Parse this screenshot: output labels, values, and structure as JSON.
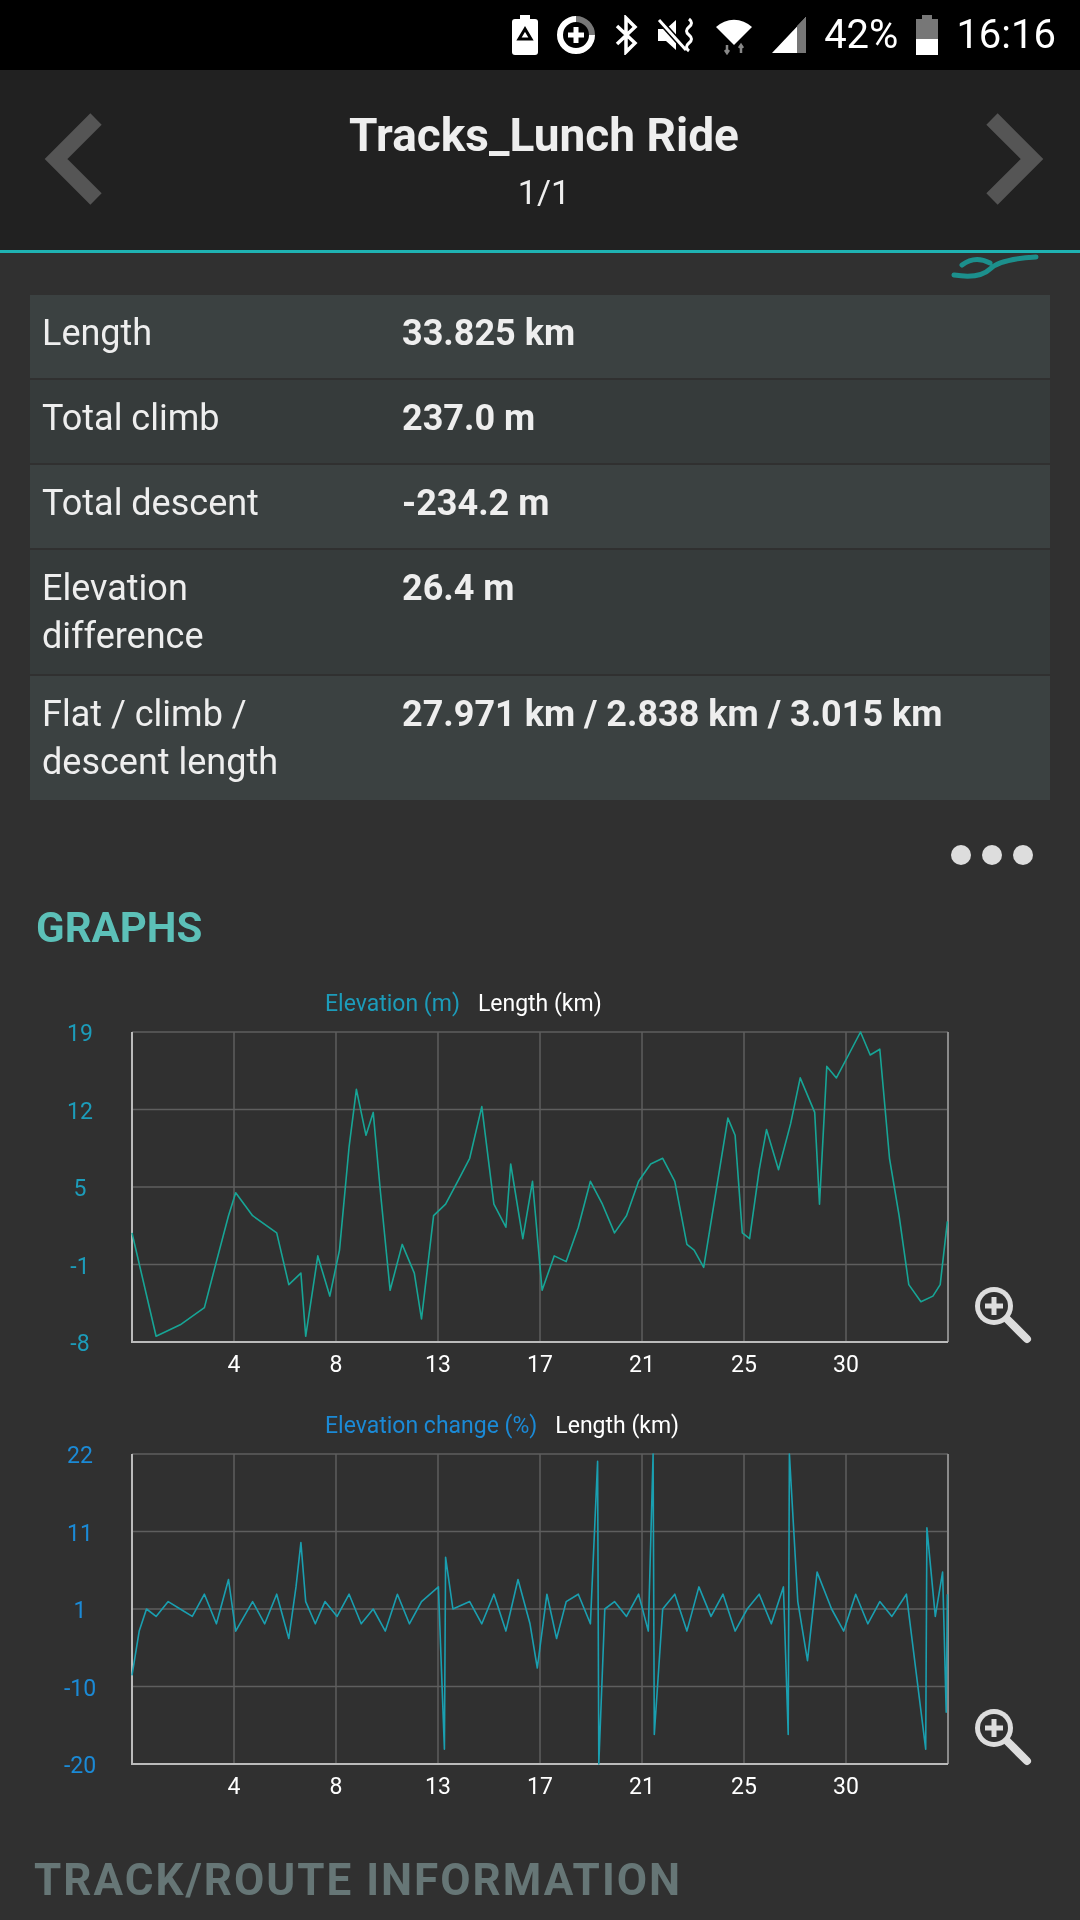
{
  "status_bar": {
    "battery_percent": "42%",
    "time": "16:16"
  },
  "header": {
    "title": "Tracks_Lunch Ride",
    "subtitle": "1/1"
  },
  "statistics": [
    {
      "label": "Length",
      "value": "33.825 km"
    },
    {
      "label": "Total climb",
      "value": "237.0 m"
    },
    {
      "label": "Total descent",
      "value": "-234.2 m"
    },
    {
      "label": "Elevation difference",
      "value": "26.4 m"
    },
    {
      "label": "Flat / climb / descent length",
      "value": "27.971 km / 2.838 km / 3.015 km"
    }
  ],
  "graphs": {
    "title": "GRAPHS",
    "charts": [
      {
        "chart_data": {
          "type": "line",
          "grid": true,
          "xlabel": "Length (km)",
          "xlim": [
            0,
            33.825
          ],
          "ylim": [
            -8,
            19
          ],
          "xticks": [
            {
              "value": 4.228,
              "label": "4"
            },
            {
              "value": 8.456,
              "label": "8"
            },
            {
              "value": 12.684,
              "label": "13"
            },
            {
              "value": 16.913,
              "label": "17"
            },
            {
              "value": 21.141,
              "label": "21"
            },
            {
              "value": 25.369,
              "label": "25"
            },
            {
              "value": 29.597,
              "label": "30"
            }
          ],
          "yticks": [
            {
              "value": -8,
              "label": "-8"
            },
            {
              "value": -1.25,
              "label": "-1"
            },
            {
              "value": 5.5,
              "label": "5"
            },
            {
              "value": 12.25,
              "label": "12"
            },
            {
              "value": 19,
              "label": "19"
            }
          ],
          "x": [
            0,
            1,
            2,
            3,
            3.5,
            4,
            4.3,
            5,
            6,
            6.5,
            7,
            7.2,
            7.7,
            8.2,
            8.6,
            9,
            9.3,
            9.7,
            10,
            10.3,
            10.7,
            11.2,
            11.7,
            12,
            12.5,
            13,
            13.5,
            14,
            14.5,
            15,
            15.5,
            15.7,
            16.2,
            16.6,
            17,
            17.5,
            18,
            18.5,
            19,
            19.5,
            20,
            20.5,
            21,
            21.5,
            22,
            22.5,
            23,
            23.3,
            23.7,
            24.2,
            24.7,
            25,
            25.3,
            25.6,
            26,
            26.3,
            26.8,
            27.3,
            27.7,
            28.3,
            28.5,
            28.8,
            29.2,
            29.7,
            30.2,
            30.6,
            31,
            31.4,
            31.8,
            32.2,
            32.7,
            33.2,
            33.5,
            33.8
          ],
          "series": [
            {
              "name": "Elevation (m)",
              "color": "#17a596",
              "values": [
                1.5,
                -7.5,
                -6.5,
                -5,
                -1,
                3,
                5,
                3,
                1.5,
                -3,
                -2,
                -7.5,
                -0.5,
                -4,
                0,
                9,
                14,
                10,
                12,
                5,
                -3.5,
                0.5,
                -2,
                -6,
                3,
                4,
                6,
                8,
                12.5,
                4,
                2,
                7.5,
                1,
                6,
                -3.5,
                -0.5,
                -1,
                2,
                6,
                4,
                1.5,
                3,
                6,
                7.5,
                8,
                6,
                0.5,
                0,
                -1.5,
                5,
                11.5,
                10,
                1.5,
                1,
                7,
                10.5,
                7,
                11,
                15,
                12,
                4,
                16,
                15,
                17,
                19,
                17,
                17.5,
                8,
                3,
                -3,
                -4.5,
                -4,
                -3,
                2.5
              ]
            }
          ]
        }
      },
      {
        "chart_data": {
          "type": "line",
          "grid": true,
          "xlabel": "Length (km)",
          "xlim": [
            0,
            33.825
          ],
          "ylim": [
            -20,
            22
          ],
          "xticks": [
            {
              "value": 4.228,
              "label": "4"
            },
            {
              "value": 8.456,
              "label": "8"
            },
            {
              "value": 12.684,
              "label": "13"
            },
            {
              "value": 16.913,
              "label": "17"
            },
            {
              "value": 21.141,
              "label": "21"
            },
            {
              "value": 25.369,
              "label": "25"
            },
            {
              "value": 29.597,
              "label": "30"
            }
          ],
          "yticks": [
            {
              "value": -20,
              "label": "-20"
            },
            {
              "value": -9.5,
              "label": "-10"
            },
            {
              "value": 1,
              "label": "1"
            },
            {
              "value": 11.5,
              "label": "11"
            },
            {
              "value": 22,
              "label": "22"
            }
          ],
          "x": [
            0,
            0.3,
            0.6,
            1,
            1.5,
            2,
            2.5,
            3,
            3.5,
            4,
            4.3,
            5,
            5.5,
            6,
            6.5,
            6.8,
            7,
            7.2,
            7.6,
            8,
            8.5,
            9,
            9.5,
            10,
            10.5,
            11,
            11.5,
            12,
            12.7,
            12.95,
            13,
            13.3,
            14,
            14.5,
            15,
            15.5,
            16,
            16.5,
            16.8,
            17.2,
            17.6,
            18,
            18.5,
            19,
            19.3,
            19.35,
            19.6,
            20,
            20.5,
            21,
            21.4,
            21.6,
            21.65,
            22,
            22.5,
            23,
            23.5,
            24,
            24.5,
            25,
            25.5,
            26,
            26.5,
            27,
            27.2,
            27.25,
            27.6,
            28,
            28.4,
            29,
            29.5,
            30,
            30.5,
            31,
            31.5,
            32.1,
            32.9,
            32.95,
            33.3,
            33.6,
            33.75,
            33.8
          ],
          "series": [
            {
              "name": "Elevation change (%)",
              "color": "#1a9fb0",
              "values": [
                -8,
                -2,
                1,
                0,
                2,
                1,
                0,
                3,
                -1,
                5,
                -2,
                2,
                -1,
                3,
                -3,
                4,
                10,
                2,
                -1,
                2,
                0,
                3,
                -1,
                1,
                -2,
                3,
                -1,
                2,
                4,
                -18,
                8,
                1,
                2,
                -1,
                3,
                -2,
                5,
                -1,
                -7,
                3,
                -3,
                2,
                3,
                -1,
                21,
                -20,
                1,
                2,
                0,
                3,
                -2,
                22,
                -16,
                1,
                3,
                -2,
                4,
                0,
                3,
                -2,
                1,
                3,
                -1,
                4,
                -16,
                22,
                2,
                -6,
                6,
                1,
                -2,
                3,
                -1,
                2,
                0,
                3,
                -18,
                12,
                0,
                6,
                -13,
                3
              ]
            }
          ]
        }
      }
    ]
  },
  "next_section": {
    "title": "TRACK/ROUTE INFORMATION"
  }
}
